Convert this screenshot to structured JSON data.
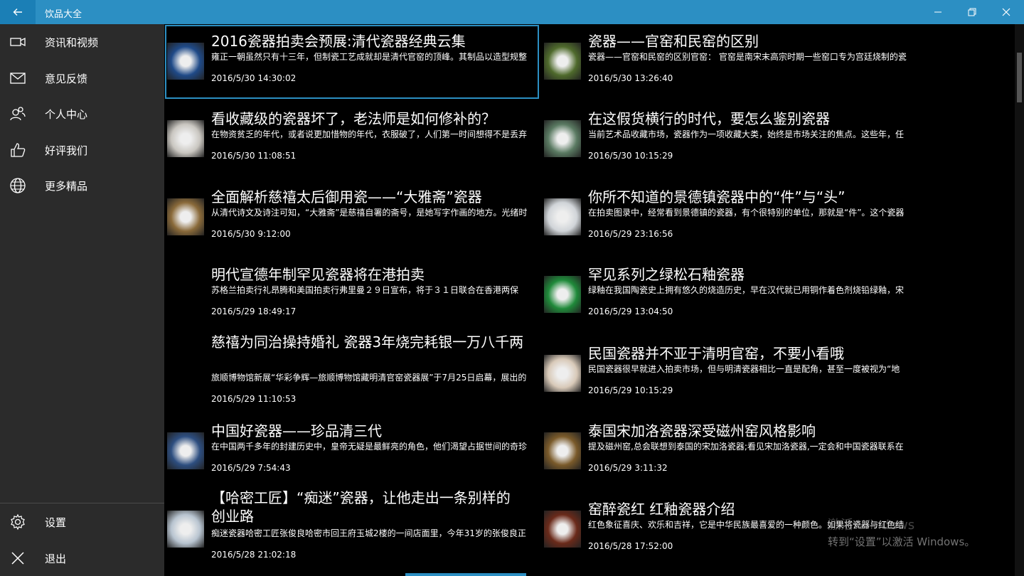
{
  "window": {
    "title": "饮品大全",
    "back_icon": "arrow-left-icon",
    "minimize_icon": "minimize-icon",
    "restore_icon": "restore-icon",
    "close_icon": "close-icon"
  },
  "sidebar": {
    "top_items": [
      {
        "label": "资讯和视频",
        "icon": "video-camera-icon"
      },
      {
        "label": "意见反馈",
        "icon": "mail-icon"
      },
      {
        "label": "个人中心",
        "icon": "people-icon"
      },
      {
        "label": "好评我们",
        "icon": "thumbs-up-icon"
      },
      {
        "label": "更多精品",
        "icon": "globe-icon"
      }
    ],
    "bottom_items": [
      {
        "label": "设置",
        "icon": "gear-icon"
      },
      {
        "label": "退出",
        "icon": "close-icon"
      }
    ]
  },
  "articles": [
    {
      "title": "2016瓷器拍卖会预展:清代瓷器经典云集",
      "summary": "雍正一朝虽然只有十三年，但制瓷工艺成就却是清代官窑的顶峰。其制品以造型规整",
      "date": "2016/5/30 14:30:02",
      "selected": true,
      "thumb_color": "#1f4a88"
    },
    {
      "title": "瓷器——官窑和民窑的区别",
      "summary": "瓷器——官窑和民窑的区别官窑： 官窑是南宋末高宗时期一些窑口专为宫廷烧制的瓷",
      "date": "2016/5/30 13:26:40",
      "thumb_color": "#4f6a2c"
    },
    {
      "title": "看收藏级的瓷器坏了，老法师是如何修补的？",
      "summary": "在物资贫乏的年代，或者说更加惜物的年代，衣服破了，人们第一时间想得不是丢弃",
      "date": "2016/5/30 11:08:51",
      "thumb_color": "#c9c6c0"
    },
    {
      "title": "在这假货横行的时代，要怎么鉴别瓷器",
      "summary": "当前艺术品收藏市场，瓷器作为一项收藏大类，始终是市场关注的焦点。这些年，任",
      "date": "2016/5/30 10:15:29",
      "thumb_color": "#5a7a62"
    },
    {
      "title": "全面解析慈禧太后御用瓷——“大雅斋”瓷器",
      "summary": "从清代诗文及诗注可知，“大雅斋”是慈禧自署的斋号，是她写字作画的地方。光绪时",
      "date": "2016/5/30 9:12:00",
      "thumb_color": "#8a6a3a"
    },
    {
      "title": "你所不知道的景德镇瓷器中的“件”与“头”",
      "summary": "在拍卖图录中，经常看到景德镇的瓷器，有个很特别的单位，那就是“件”。这个瓷器",
      "date": "2016/5/29 23:16:56",
      "thumb_color": "#d0d4d8"
    },
    {
      "title": "明代宣德年制罕见瓷器将在港拍卖",
      "summary": "苏格兰拍卖行礼昂腾和美国拍卖行弗里曼２９日宣布，将于３１日联合在香港两保",
      "date": "2016/5/29 18:49:17",
      "thumb_color": ""
    },
    {
      "title": "罕见系列之绿松石釉瓷器",
      "summary": "绿釉在我国陶瓷史上拥有悠久的烧造历史，早在汉代就已用铜作着色剂烧铅绿釉，宋",
      "date": "2016/5/29 13:04:50",
      "thumb_color": "#1f8a3a"
    },
    {
      "title": "慈禧为同治操持婚礼 瓷器3年烧完耗银一万八千两",
      "summary": "旅顺博物馆新展“华彩争辉—旅顺博物馆藏明清官窑瓷器展”于7月25日启幕，展出的",
      "date": "2016/5/29 11:10:53",
      "thumb_color": ""
    },
    {
      "title": "民国瓷器并不亚于清明官窑，不要小看哦",
      "summary": "民国瓷器很早就进入拍卖市场，但与明清瓷器相比一直是配角，甚至一度被视为“地",
      "date": "2016/5/29 10:15:29",
      "thumb_color": "#d8c9b8"
    },
    {
      "title": "中国好瓷器——珍品清三代",
      "summary": "在中国两千多年的封建历史中，皇帝无疑是最鲜亮的角色，他们渴望占据世间的奇珍",
      "date": "2016/5/29 7:54:43",
      "thumb_color": "#2d4e80"
    },
    {
      "title": "泰国宋加洛瓷器深受磁州窑风格影响",
      "summary": "提及磁州窑,总会联想到泰国的宋加洛瓷器;看见宋加洛瓷器,一定会和中国瓷器联系在",
      "date": "2016/5/29 3:11:32",
      "thumb_color": "#7a5a2a"
    },
    {
      "title": "【哈密工匠】“痴迷”瓷器，让他走出一条别样的创业路",
      "summary": "痴迷瓷器哈密工匠张俊良哈密市回王府玉城2楼的一间店面里，今年31岁的张俊良正",
      "date": "2016/5/28 21:02:18",
      "thumb_color": "#b8c4d0"
    },
    {
      "title": "窑醉瓷红 红釉瓷器介绍",
      "summary": "红色象征喜庆、欢乐和吉祥，它是中华民族最喜爱的一种颜色。如果将瓷器与红色结",
      "date": "2016/5/28 17:52:00",
      "thumb_color": "#6a2a1a"
    }
  ],
  "watermark": {
    "line1": "激活 Windows",
    "line2": "转到“设置”以激活 Windows。"
  }
}
